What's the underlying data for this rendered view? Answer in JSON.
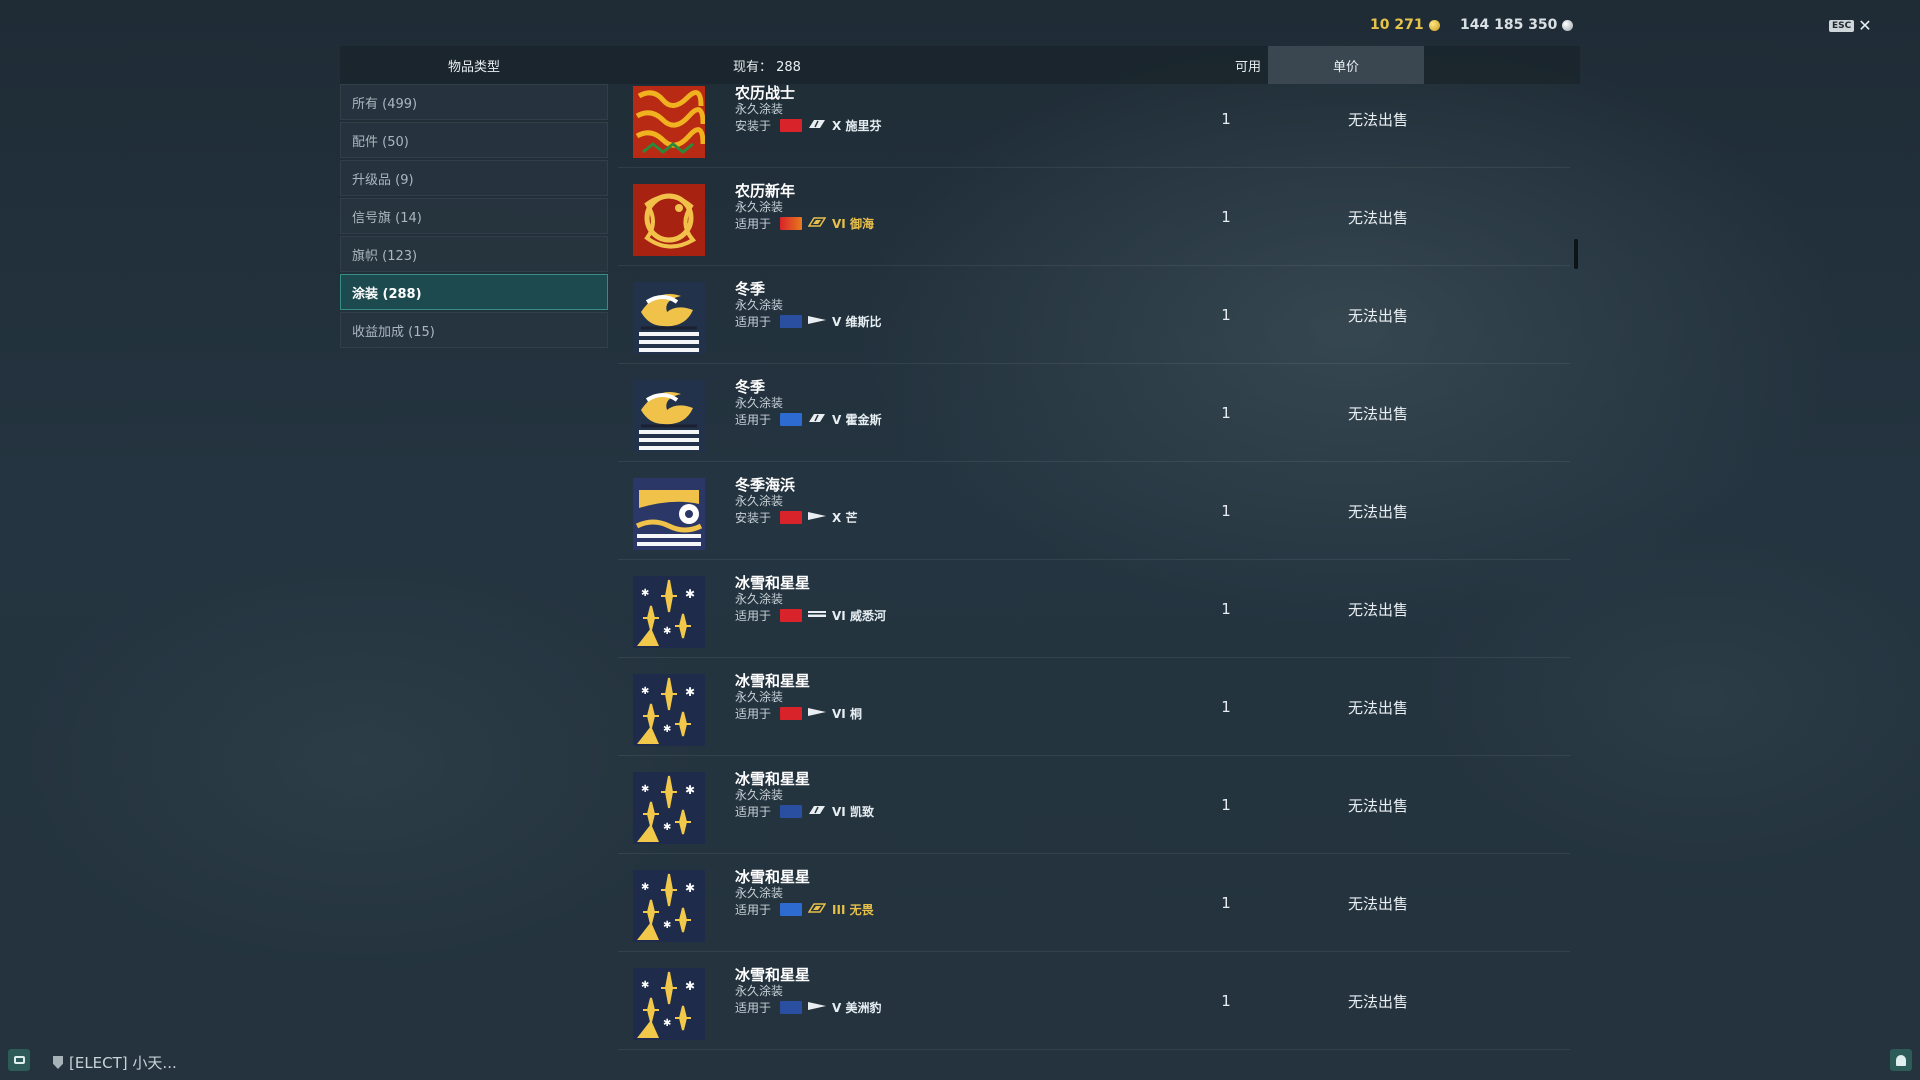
{
  "currency": {
    "credits": "10 271",
    "silver": "144 185 350"
  },
  "esc": {
    "key": "ESC",
    "close": "✕"
  },
  "header": {
    "type": "物品类型",
    "count": "现有： 288",
    "available": "可用",
    "price": "单价"
  },
  "categories": [
    {
      "label": "所有 (499)"
    },
    {
      "label": "配件 (50)"
    },
    {
      "label": "升级品 (9)"
    },
    {
      "label": "信号旗 (14)"
    },
    {
      "label": "旗帜 (123)"
    },
    {
      "label": "涂装 (288)"
    },
    {
      "label": "收益加成 (15)"
    }
  ],
  "items": [
    {
      "name": "农历战士",
      "type": "永久涂装",
      "prefix": "安装于",
      "flag": "red-cross",
      "ship_class": "cruiser",
      "tier": "X 施里芬",
      "gold": false,
      "thumb": "dragon-red",
      "available": "1",
      "price": "无法出售"
    },
    {
      "name": "农历新年",
      "type": "永久涂装",
      "prefix": "适用于",
      "flag": "red-orange",
      "ship_class": "cruiser-premium",
      "tier": "VI 御海",
      "gold": true,
      "thumb": "dragon-gold",
      "available": "1",
      "price": "无法出售"
    },
    {
      "name": "冬季",
      "type": "永久涂装",
      "prefix": "适用于",
      "flag": "blue-emblem",
      "ship_class": "destroyer",
      "tier": "V 维斯比",
      "gold": false,
      "thumb": "winter",
      "available": "1",
      "price": "无法出售"
    },
    {
      "name": "冬季",
      "type": "永久涂装",
      "prefix": "适用于",
      "flag": "blue-plane",
      "ship_class": "cruiser",
      "tier": "V 霍金斯",
      "gold": false,
      "thumb": "winter",
      "available": "1",
      "price": "无法出售"
    },
    {
      "name": "冬季海浜",
      "type": "永久涂装",
      "prefix": "安装于",
      "flag": "red-cross",
      "ship_class": "destroyer",
      "tier": "X 芒",
      "gold": false,
      "thumb": "winter-sea",
      "available": "1",
      "price": "无法出售"
    },
    {
      "name": "冰雪和星星",
      "type": "永久涂装",
      "prefix": "适用于",
      "flag": "red-cross",
      "ship_class": "battleship",
      "tier": "VI 威悉河",
      "gold": false,
      "thumb": "stars",
      "available": "1",
      "price": "无法出售"
    },
    {
      "name": "冰雪和星星",
      "type": "永久涂装",
      "prefix": "适用于",
      "flag": "red-cross",
      "ship_class": "destroyer",
      "tier": "VI 桐",
      "gold": false,
      "thumb": "stars",
      "available": "1",
      "price": "无法出售"
    },
    {
      "name": "冰雪和星星",
      "type": "永久涂装",
      "prefix": "适用于",
      "flag": "blue-emblem",
      "ship_class": "cruiser",
      "tier": "VI 凯致",
      "gold": false,
      "thumb": "stars",
      "available": "1",
      "price": "无法出售"
    },
    {
      "name": "冰雪和星星",
      "type": "永久涂装",
      "prefix": "适用于",
      "flag": "blue-plane",
      "ship_class": "cruiser-premium",
      "tier": "III 无畏",
      "gold": true,
      "thumb": "stars",
      "available": "1",
      "price": "无法出售"
    },
    {
      "name": "冰雪和星星",
      "type": "永久涂装",
      "prefix": "适用于",
      "flag": "blue-emblem",
      "ship_class": "destroyer",
      "tier": "V 美洲豹",
      "gold": false,
      "thumb": "stars",
      "available": "1",
      "price": "无法出售"
    }
  ],
  "bottom": {
    "clan": "[ELECT]  小天..."
  },
  "colors": {
    "accent": "#3a8a85",
    "gold": "#e8c04a",
    "active_category": "#1d4a4f"
  }
}
